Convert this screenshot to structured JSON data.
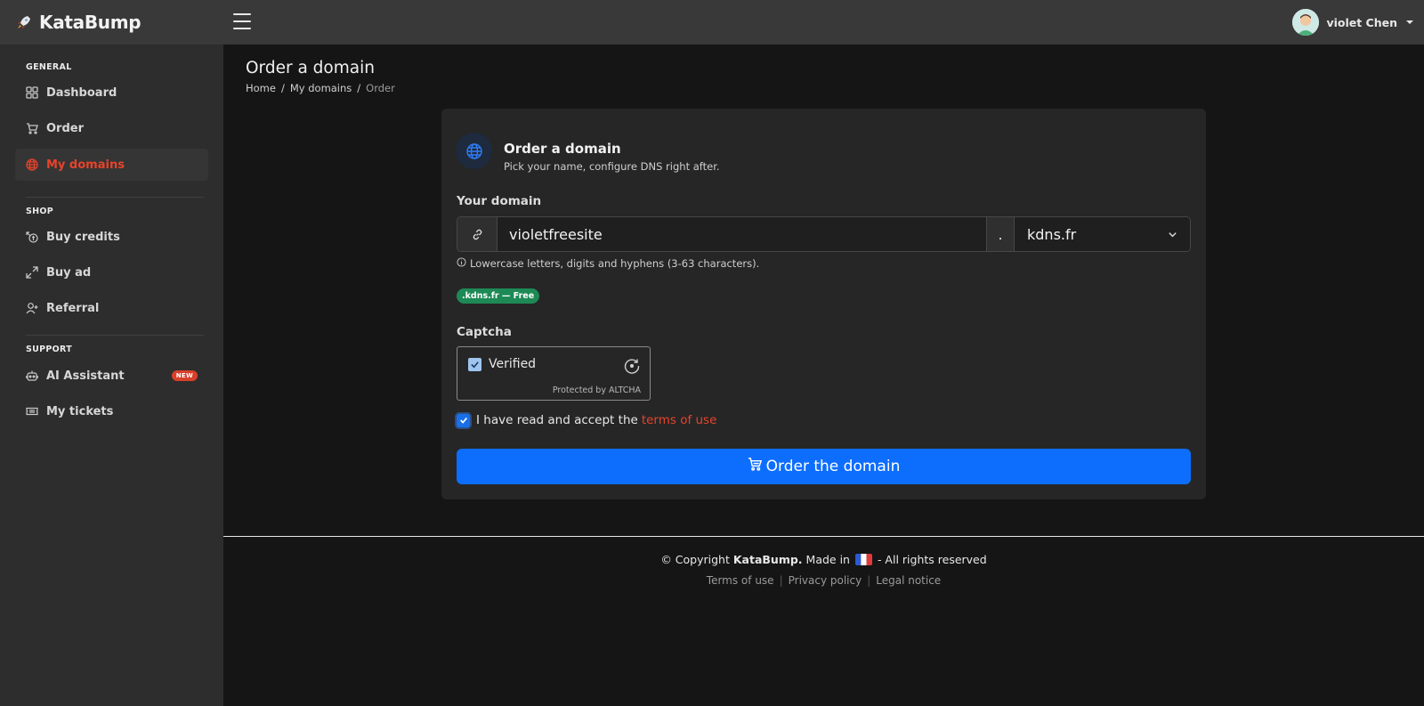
{
  "brand": {
    "name": "KataBump",
    "logo_icon": "rocket-icon"
  },
  "user": {
    "name": "violet Chen",
    "avatar_icon": "avatar-icon"
  },
  "sidebar": {
    "sections": [
      {
        "title": "GENERAL"
      },
      {
        "title": "SHOP"
      },
      {
        "title": "SUPPORT"
      }
    ],
    "items": [
      {
        "label": "Dashboard",
        "icon": "grid-icon"
      },
      {
        "label": "Order",
        "icon": "cart-icon"
      },
      {
        "label": "My domains",
        "icon": "globe-icon",
        "active": true
      },
      {
        "label": "Buy credits",
        "icon": "coins-icon"
      },
      {
        "label": "Buy ad",
        "icon": "expand-arrows-icon"
      },
      {
        "label": "Referral",
        "icon": "user-plus-icon"
      },
      {
        "label": "AI Assistant",
        "icon": "robot-icon",
        "badge": "NEW"
      },
      {
        "label": "My tickets",
        "icon": "ticket-icon"
      }
    ]
  },
  "page": {
    "title": "Order a domain",
    "breadcrumb": [
      "Home",
      "My domains",
      "Order"
    ]
  },
  "card": {
    "title": "Order a domain",
    "subtitle": "Pick your name, configure DNS right after.",
    "domain_label": "Your domain",
    "domain_value": "violetfreesite",
    "dot": ".",
    "tld_selected": "kdns.fr",
    "hint": "Lowercase letters, digits and hyphens (3-63 characters).",
    "price_pill": ".kdns.fr — Free",
    "captcha_label": "Captcha",
    "captcha_status": "Verified",
    "captcha_footer": "Protected by ALTCHA",
    "terms_prefix": "I have read and accept the",
    "terms_link": "terms of use",
    "order_button": "Order the domain"
  },
  "footer": {
    "copyright_prefix": "© Copyright",
    "brand": "KataBump.",
    "made_in": "Made in",
    "rights": "- All rights reserved",
    "links": [
      "Terms of use",
      "Privacy policy",
      "Legal notice"
    ]
  },
  "colors": {
    "accent": "#e8432a",
    "primary": "#0d6efd",
    "success": "#1d8a55",
    "sidebar_bg": "#2d2d2d",
    "topbar_bg": "#393939",
    "content_bg": "#151515"
  }
}
